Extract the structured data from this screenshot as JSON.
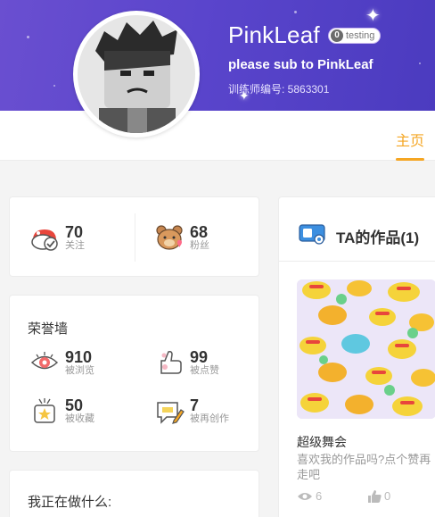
{
  "profile": {
    "username": "PinkLeaf",
    "level": "0",
    "badge_text": "testing",
    "tagline": "please sub to PinkLeaf",
    "trainer_id": "训练师编号: 5863301"
  },
  "nav": {
    "home_tab": "主页"
  },
  "follow_stats": [
    {
      "value": "70",
      "label": "关注",
      "icon": "follow-icon"
    },
    {
      "value": "68",
      "label": "粉丝",
      "icon": "fans-icon"
    }
  ],
  "honor": {
    "title": "荣誉墙",
    "items": [
      {
        "value": "910",
        "label": "被浏览",
        "icon": "eye-icon"
      },
      {
        "value": "99",
        "label": "被点赞",
        "icon": "like-icon"
      },
      {
        "value": "50",
        "label": "被收藏",
        "icon": "star-icon"
      },
      {
        "value": "7",
        "label": "被再创作",
        "icon": "remix-icon"
      }
    ]
  },
  "doing": {
    "title": "我正在做什么:"
  },
  "works": {
    "title": "TA的作品(1)",
    "items": [
      {
        "title": "超级舞会",
        "description": "喜欢我的作品吗?点个赞再走吧",
        "views": "6",
        "likes": "0"
      }
    ]
  },
  "colors": {
    "banner": "#5a45cc",
    "accent": "#f5a623"
  }
}
